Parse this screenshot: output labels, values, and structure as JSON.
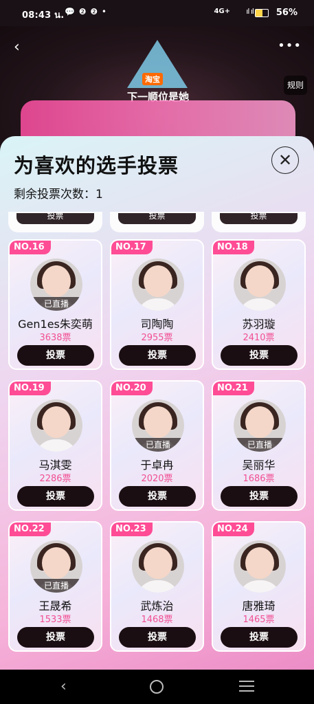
{
  "status_bar": {
    "time": "08:43 น.",
    "notifications": "💬 ❷ ❷ •",
    "network": "4G+",
    "signal_bars": "ıl ıl",
    "battery": "56%",
    "battery_level": 0.56
  },
  "banner": {
    "brand_badge": "淘宝",
    "logo_text": "下一顺位是她",
    "rules_label": "规则"
  },
  "sheet": {
    "title": "为喜欢的选手投票",
    "remaining_label": "剩余投票次数：",
    "remaining_count": "1",
    "partial_vote_label": "投票"
  },
  "contestants": [
    {
      "rank": "NO.16",
      "name": "Gen1es朱奕萌",
      "votes": "3638票",
      "live": "已直播",
      "vote_label": "投票"
    },
    {
      "rank": "NO.17",
      "name": "司陶陶",
      "votes": "2955票",
      "live": "",
      "vote_label": "投票"
    },
    {
      "rank": "NO.18",
      "name": "苏羽璇",
      "votes": "2410票",
      "live": "",
      "vote_label": "投票"
    },
    {
      "rank": "NO.19",
      "name": "马淇雯",
      "votes": "2286票",
      "live": "",
      "vote_label": "投票"
    },
    {
      "rank": "NO.20",
      "name": "于卓冉",
      "votes": "2020票",
      "live": "已直播",
      "vote_label": "投票"
    },
    {
      "rank": "NO.21",
      "name": "吴丽华",
      "votes": "1686票",
      "live": "已直播",
      "vote_label": "投票"
    },
    {
      "rank": "NO.22",
      "name": "王晟希",
      "votes": "1533票",
      "live": "已直播",
      "vote_label": "投票"
    },
    {
      "rank": "NO.23",
      "name": "武炼治",
      "votes": "1468票",
      "live": "",
      "vote_label": "投票"
    },
    {
      "rank": "NO.24",
      "name": "唐雅琦",
      "votes": "1465票",
      "live": "",
      "vote_label": "投票"
    }
  ]
}
